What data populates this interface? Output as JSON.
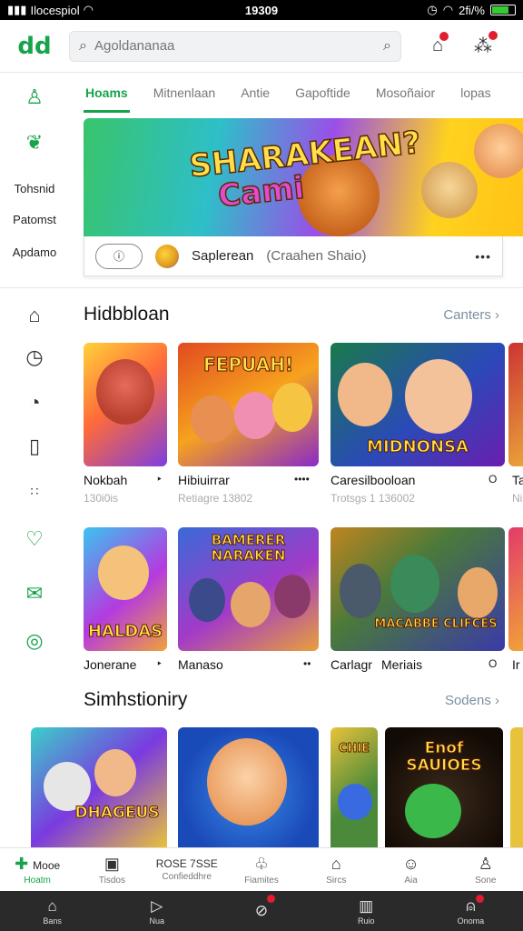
{
  "status_bar": {
    "carrier": "Ilocespiol",
    "time": "19309",
    "battery": "2fi/%"
  },
  "top_bar": {
    "logo": "dd",
    "search_placeholder": "Agoldananaa"
  },
  "left_rail": {
    "labels": [
      "Tohsnid",
      "Patomst",
      "Apdamo"
    ],
    "icons": [
      "account-icon",
      "leaf-icon",
      "home-icon",
      "clock-icon",
      "timer-icon",
      "book-icon",
      "dots-icon",
      "heart-icon",
      "gift-icon",
      "camera-icon"
    ]
  },
  "tabs": [
    "Hoams",
    "Mitnenlaan",
    "Antie",
    "Gapoftide",
    "Mosoñaior",
    "lopas"
  ],
  "banner": {
    "title_line1": "SHARAKEAN?",
    "title_line2": "Cami",
    "info_name": "Saplerean",
    "info_sub": "(Craahen Shaio)",
    "more": "•••"
  },
  "sections": [
    {
      "title": "Hidbbloan",
      "link": "Canters ›"
    },
    {
      "title": "Simhstioniry",
      "link": "Sodens ›"
    }
  ],
  "row1": [
    {
      "name": "Nokbah",
      "meta": "130i0is",
      "more": "‣",
      "art": ""
    },
    {
      "name": "Hibiuirrar",
      "meta": "Retiagre 13802",
      "more": "••••",
      "art": "FEPUAH!"
    },
    {
      "name": "Caresilbooloan",
      "meta": "Trotsgs 1 136002",
      "more": "O",
      "art": "MIDNONSA"
    },
    {
      "name": "Ta",
      "meta": "Ni",
      "more": "",
      "art": ""
    }
  ],
  "row2": [
    {
      "name": "Jonerane",
      "meta": "",
      "more": "‣",
      "art": "HALDAS"
    },
    {
      "name": "Manaso",
      "meta": "",
      "more": "••",
      "art": "BAMERER NARAKEN"
    },
    {
      "name": "Carlagr",
      "meta": "",
      "more": "",
      "art": ""
    },
    {
      "name": "Meriais",
      "meta": "",
      "more": "O",
      "art": "MACABBE CLIFCES"
    },
    {
      "name": "Ir",
      "meta": "",
      "more": "",
      "art": ""
    }
  ],
  "row3": [
    {
      "art": "DHAGEUS"
    },
    {
      "art": ""
    },
    {
      "art": "CHIE"
    },
    {
      "art": "Enof SAUIOES"
    }
  ],
  "bottom_nav": [
    {
      "label": "Hoatm",
      "extra": "Mooe",
      "icon": "gamepad-icon",
      "active": true
    },
    {
      "label": "Tisdos",
      "extra": "",
      "icon": "message-icon",
      "active": false
    },
    {
      "label": "Confieddhre",
      "extra": "ROSE 7SSE",
      "icon": "apps-icon",
      "active": false
    },
    {
      "label": "Fiamites",
      "extra": "",
      "icon": "user-group-icon",
      "active": false
    },
    {
      "label": "Sircs",
      "extra": "",
      "icon": "house-icon",
      "active": false
    },
    {
      "label": "Aia",
      "extra": "",
      "icon": "chat-icon",
      "active": false
    },
    {
      "label": "Sone",
      "extra": "",
      "icon": "profile-icon",
      "active": false
    }
  ],
  "system_nav": [
    {
      "label": "Bans",
      "icon": "home-icon"
    },
    {
      "label": "Nua",
      "icon": "play-icon"
    },
    {
      "label": "",
      "icon": "compass-icon",
      "badge": true
    },
    {
      "label": "Ruio",
      "icon": "book-icon"
    },
    {
      "label": "Onoma",
      "icon": "user-icon",
      "badge": true
    }
  ]
}
